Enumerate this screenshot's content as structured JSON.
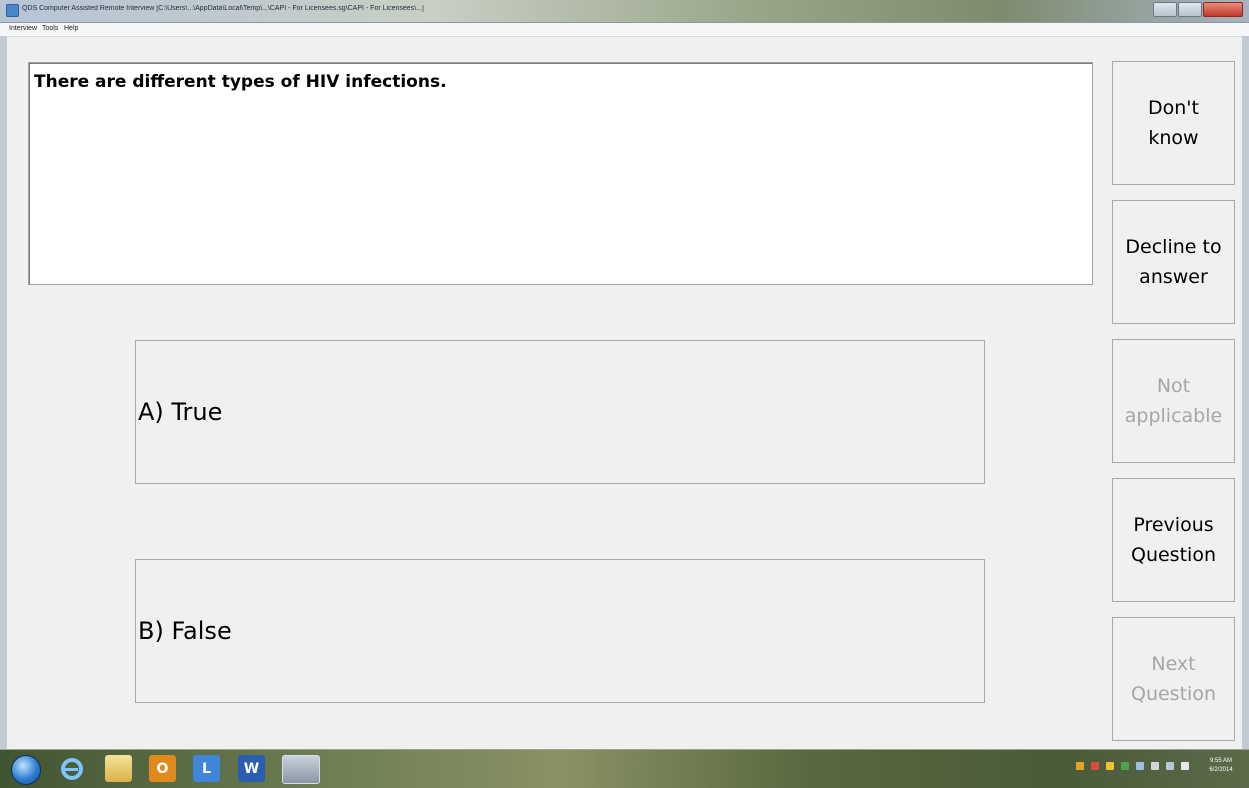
{
  "window": {
    "title": "QDS Computer Assisted Remote Interview [C:\\Users\\...\\AppData\\Local\\Temp\\...\\CAPI - For Licensees.sg\\CAPI - For Licensees\\...]"
  },
  "menu": {
    "items": [
      {
        "label": "Interview"
      },
      {
        "label": "Tools"
      },
      {
        "label": "Help"
      }
    ]
  },
  "question": {
    "text": "There are different types of HIV infections."
  },
  "options": [
    {
      "label": "A) True"
    },
    {
      "label": "B) False"
    }
  ],
  "side_buttons": {
    "dont_know": {
      "label": "Don't\nknow",
      "enabled": true
    },
    "decline": {
      "label": "Decline to\nanswer",
      "enabled": true
    },
    "not_applicable": {
      "label": "Not\napplicable",
      "enabled": false
    },
    "previous": {
      "label": "Previous\nQuestion",
      "enabled": true
    },
    "next": {
      "label": "Next\nQuestion",
      "enabled": false
    }
  },
  "taskbar": {
    "apps": [
      {
        "icon": "internet-explorer-icon"
      },
      {
        "icon": "folder-icon"
      },
      {
        "icon": "outlook-icon",
        "glyph": "O"
      },
      {
        "icon": "lync-icon",
        "glyph": "L"
      },
      {
        "icon": "word-icon",
        "glyph": "W"
      },
      {
        "icon": "qds-app-icon"
      }
    ],
    "clock": {
      "time": "9:55 AM",
      "date": "6/2/2014"
    }
  },
  "colors": {
    "background": "#f0f0f0",
    "disabled_text": "#a6a6a6",
    "border": "#a9a9a9"
  }
}
